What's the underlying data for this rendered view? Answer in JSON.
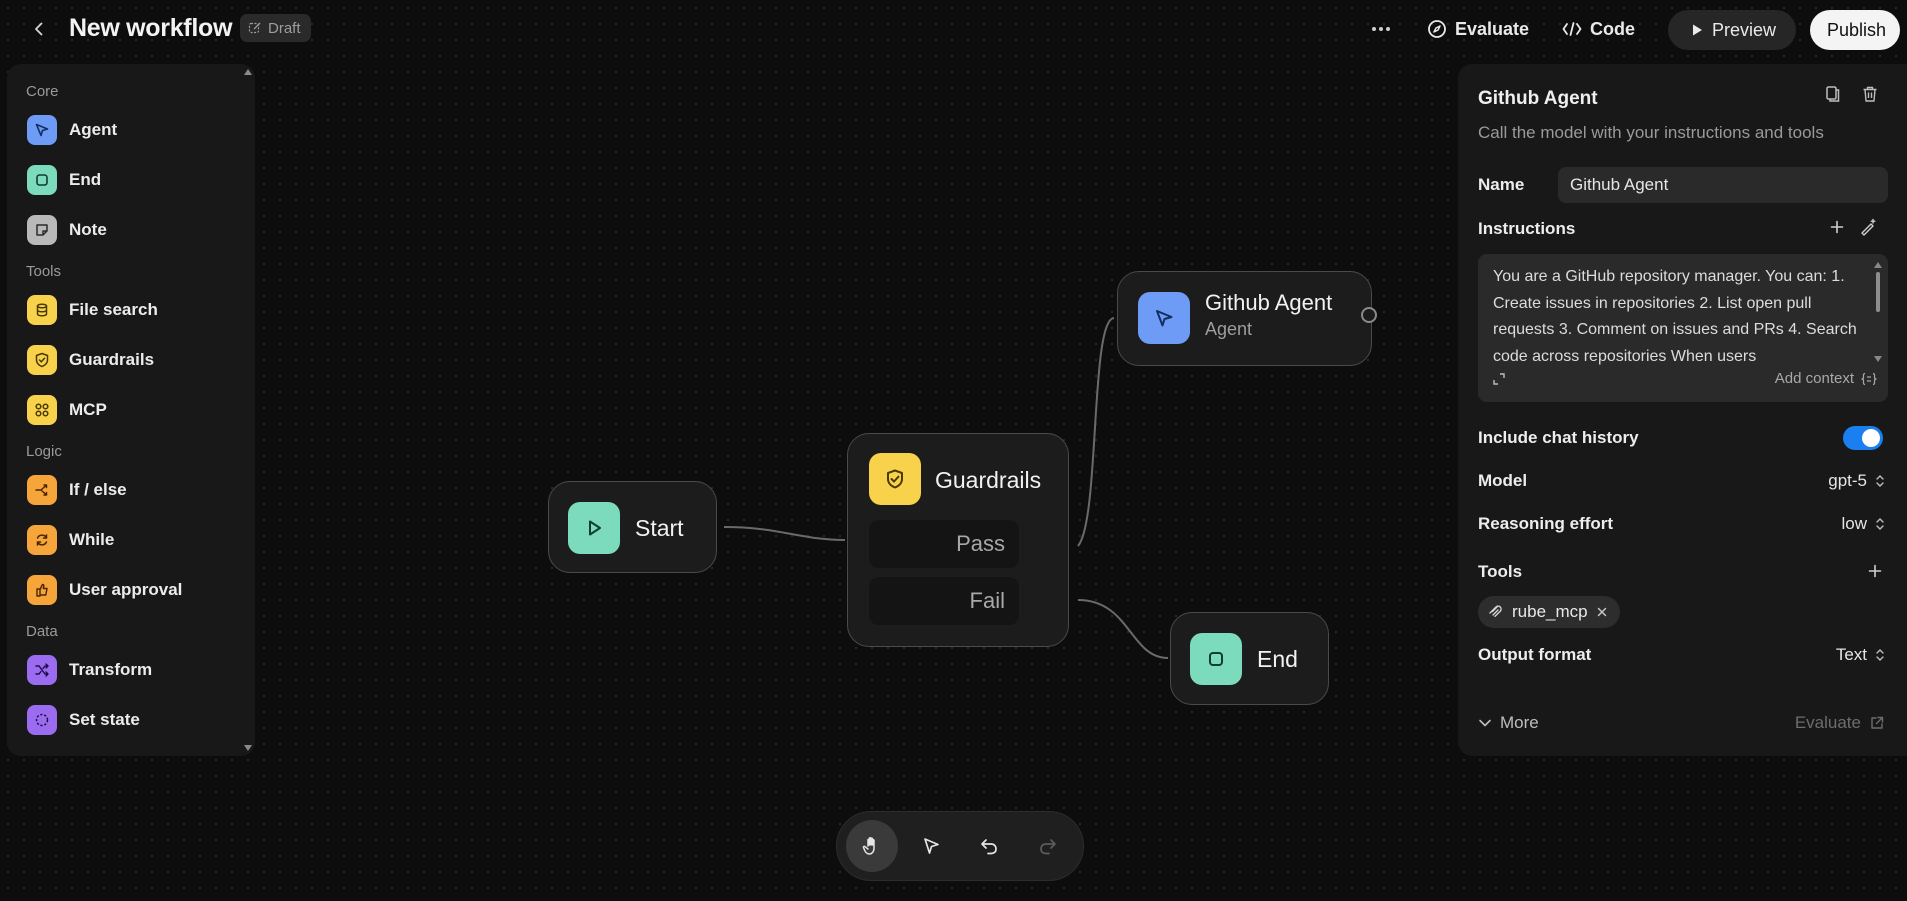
{
  "header": {
    "title": "New workflow",
    "badge": "Draft",
    "evaluate_label": "Evaluate",
    "code_label": "Code",
    "preview_label": "Preview",
    "publish_label": "Publish"
  },
  "sidebar": {
    "sections": [
      {
        "label": "Core",
        "items": [
          {
            "label": "Agent",
            "icon": "cursor-icon",
            "color": "#6e9bf5"
          },
          {
            "label": "End",
            "icon": "stop-icon",
            "color": "#7ddbbd"
          },
          {
            "label": "Note",
            "icon": "note-icon",
            "color": "#b9b9b9"
          }
        ]
      },
      {
        "label": "Tools",
        "items": [
          {
            "label": "File search",
            "icon": "database-icon",
            "color": "#f7d24a"
          },
          {
            "label": "Guardrails",
            "icon": "shield-icon",
            "color": "#f7d24a"
          },
          {
            "label": "MCP",
            "icon": "mcp-icon",
            "color": "#f7d24a"
          }
        ]
      },
      {
        "label": "Logic",
        "items": [
          {
            "label": "If / else",
            "icon": "branch-icon",
            "color": "#f6a53a"
          },
          {
            "label": "While",
            "icon": "loop-icon",
            "color": "#f6a53a"
          },
          {
            "label": "User approval",
            "icon": "approval-icon",
            "color": "#f6a53a"
          }
        ]
      },
      {
        "label": "Data",
        "items": [
          {
            "label": "Transform",
            "icon": "shuffle-icon",
            "color": "#9b6cf0"
          },
          {
            "label": "Set state",
            "icon": "state-icon",
            "color": "#9b6cf0"
          }
        ]
      }
    ]
  },
  "canvas": {
    "start": {
      "label": "Start",
      "color": "#7ddbbd"
    },
    "guardrails": {
      "label": "Guardrails",
      "pass": "Pass",
      "fail": "Fail",
      "color": "#f7d24a"
    },
    "agent": {
      "label": "Github Agent",
      "sublabel": "Agent",
      "color": "#6e9bf5"
    },
    "end": {
      "label": "End",
      "color": "#7ddbbd"
    }
  },
  "inspector": {
    "title": "Github Agent",
    "subtitle": "Call the model with your instructions and tools",
    "name_label": "Name",
    "name_value": "Github Agent",
    "instructions_label": "Instructions",
    "instructions_text": "You are a GitHub repository manager. You can: 1. Create issues in repositories 2. List open pull requests 3. Comment on issues and PRs 4. Search code across repositories When users",
    "add_context": "Add context",
    "chat_history_label": "Include chat history",
    "chat_history_on": true,
    "model_label": "Model",
    "model_value": "gpt-5",
    "reasoning_label": "Reasoning effort",
    "reasoning_value": "low",
    "tools_label": "Tools",
    "tool_chip": "rube_mcp",
    "output_label": "Output format",
    "output_value": "Text",
    "more_label": "More",
    "evaluate_link": "Evaluate"
  },
  "toolbar": {
    "tools": [
      "hand-icon",
      "pointer-icon",
      "undo-icon",
      "redo-icon"
    ],
    "active": "hand-icon"
  }
}
